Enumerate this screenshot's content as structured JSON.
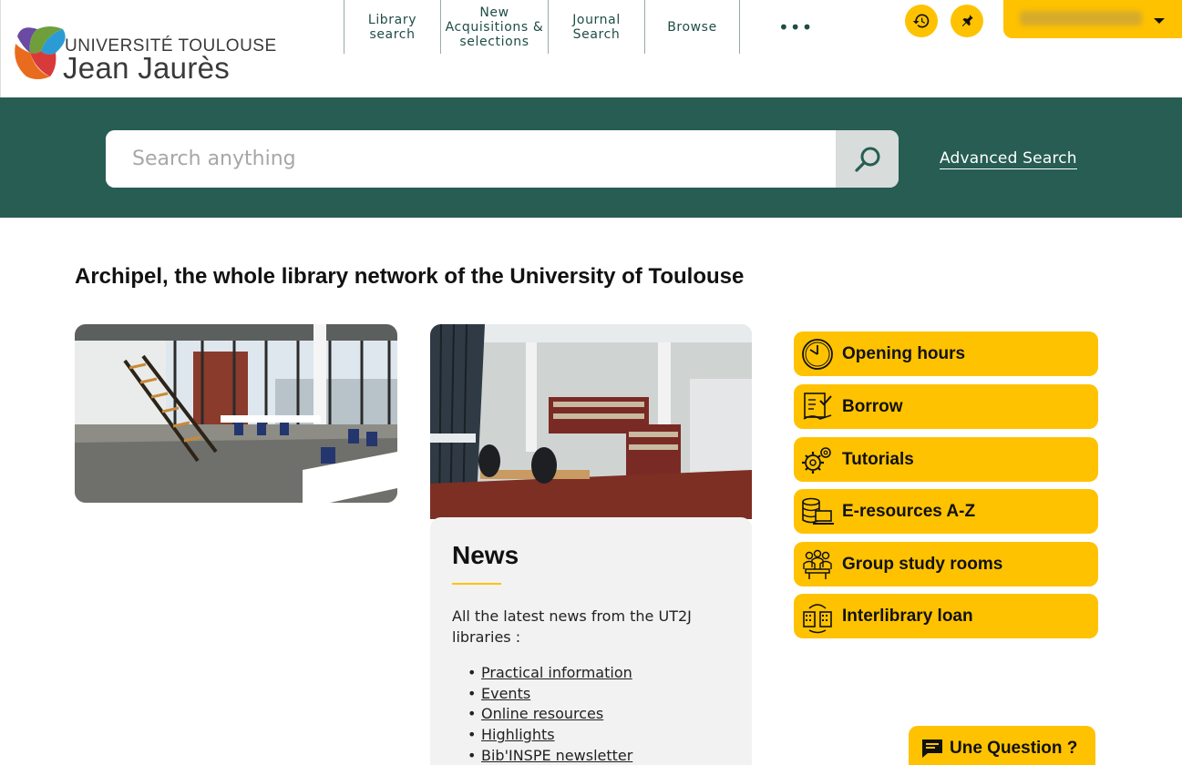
{
  "brand": {
    "line1": "UNIVERSITÉ TOULOUSE",
    "line2": "Jean Jaurès"
  },
  "nav": {
    "items": [
      {
        "label": "Library search"
      },
      {
        "label": "New Acquisitions & selections"
      },
      {
        "label": "Journal Search"
      },
      {
        "label": "Browse"
      }
    ],
    "more_label": "•••"
  },
  "header_icons": {
    "history": "history-icon",
    "pin": "pin-icon"
  },
  "search": {
    "placeholder": "Search anything",
    "value": "",
    "advanced_label": "Advanced Search"
  },
  "main": {
    "title": "Archipel, the whole library network of the University of Toulouse"
  },
  "news": {
    "title": "News",
    "description": "All the latest news from the UT2J libraries :",
    "links": [
      {
        "label": "Practical information"
      },
      {
        "label": "Events"
      },
      {
        "label": "Online resources"
      },
      {
        "label": "Highlights"
      },
      {
        "label": "Bib'INSPE newsletter"
      }
    ]
  },
  "quick_links": [
    {
      "label": "Opening hours",
      "icon": "clock-icon"
    },
    {
      "label": "Borrow",
      "icon": "borrow-icon"
    },
    {
      "label": "Tutorials",
      "icon": "gears-icon"
    },
    {
      "label": "E-resources A-Z",
      "icon": "database-laptop-icon"
    },
    {
      "label": "Group study rooms",
      "icon": "group-study-icon"
    },
    {
      "label": "Interlibrary loan",
      "icon": "buildings-exchange-icon"
    }
  ],
  "question_button": {
    "label": "Une Question ?",
    "icon": "chat-icon"
  },
  "colors": {
    "brand_green": "#275d53",
    "accent_yellow": "#fec200",
    "nav_text": "#1f4d45",
    "news_card_bg": "#f2f2f2"
  }
}
